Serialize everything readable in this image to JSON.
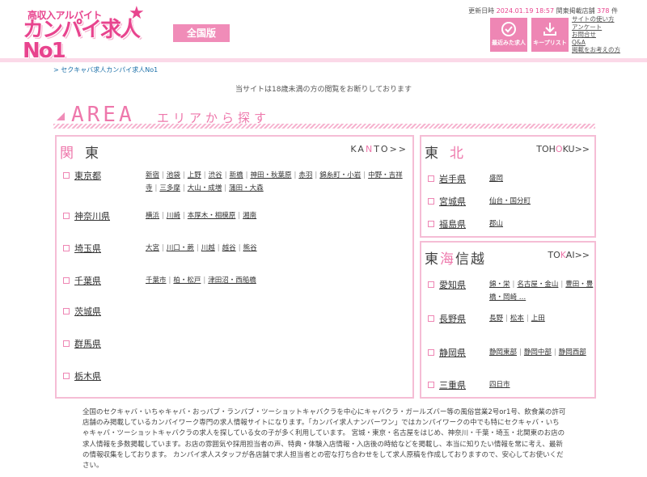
{
  "header": {
    "logo_tagline": "高収入アルバイト",
    "logo_brand": "カンパイ求人No1",
    "edition": "全国版",
    "updated_label": "更新日時",
    "updated_date": "2024.01.19 18:57",
    "shops_label": "関東掲載店舗",
    "shops_count": "378",
    "shops_unit": "件",
    "recent_label": "最近みた求人",
    "keep_label": "キープリスト",
    "links": [
      "サイトの使い方",
      "アンケート",
      "お問合せ",
      "Q&A",
      "掲載をお考えの方"
    ]
  },
  "breadcrumb": "> セクキャバ求人カンパイ求人No1",
  "notice": "当サイトは18歳未満の方の閲覧をお断りしております",
  "area_heading": {
    "en": "AREA",
    "jp": "エリアから探す"
  },
  "kanto": {
    "title_hl": "関",
    "title_rest": "東",
    "more_a": "KA",
    "more_hl": "N",
    "more_b": "TO>>",
    "prefs": [
      {
        "name": "東京都",
        "cities": [
          "新宿",
          "池袋",
          "上野",
          "渋谷",
          "新橋",
          "神田・秋葉原",
          "赤羽",
          "錦糸町・小岩",
          "中野・吉祥寺",
          "三多摩",
          "大山・成増",
          "蒲田・大森"
        ]
      },
      {
        "name": "神奈川県",
        "cities": [
          "横浜",
          "川崎",
          "本厚木・相模原",
          "湘南"
        ]
      },
      {
        "name": "埼玉県",
        "cities": [
          "大宮",
          "川口・蕨",
          "川越",
          "越谷",
          "熊谷"
        ]
      },
      {
        "name": "千葉県",
        "cities": [
          "千葉市",
          "柏・松戸",
          "津田沼・西船橋"
        ]
      },
      {
        "name": "茨城県",
        "cities": []
      },
      {
        "name": "群馬県",
        "cities": []
      },
      {
        "name": "栃木県",
        "cities": []
      }
    ]
  },
  "tohoku": {
    "title_a": "東",
    "title_hl": "北",
    "more_a": "TOH",
    "more_hl": "O",
    "more_b": "KU>>",
    "prefs": [
      {
        "name": "岩手県",
        "cities": [
          "盛岡"
        ]
      },
      {
        "name": "宮城県",
        "cities": [
          "仙台・国分町"
        ]
      },
      {
        "name": "福島県",
        "cities": [
          "郡山"
        ]
      }
    ]
  },
  "tokai": {
    "title_a": "東",
    "title_hl": "海",
    "title_b": "信越",
    "more_a": "TO",
    "more_hl": "K",
    "more_b": "AI>>",
    "prefs": [
      {
        "name": "愛知県",
        "cities": [
          "錦・栄",
          "名古屋・金山",
          "豊田・豊橋・岡崎 …"
        ]
      },
      {
        "name": "長野県",
        "cities": [
          "長野",
          "松本",
          "上田"
        ]
      },
      {
        "name": "静岡県",
        "cities": [
          "静岡東部",
          "静岡中部",
          "静岡西部"
        ]
      },
      {
        "name": "三重県",
        "cities": [
          "四日市"
        ]
      }
    ]
  },
  "footer_text": "全国のセクキャバ・いちゃキャバ・おっパブ・ランパブ・ツーショットキャバクラを中心にキャバクラ・ガールズバー等の風俗営業2号or1号、飲食業の許可店舗のみ掲載しているカンパイワーク専門の求人情報サイトになります。「カンパイ求人ナンバーワン」ではカンパイワークの中でも特にセクキャバ・いちゃキャバ・ツーショットキャバクラの求人を探している女の子が多く利用しています。 宮城・東京・名古屋をはじめ、神奈川・千葉・埼玉・北関東のお店の求人情報を多数掲載しています。お店の雰囲気や採用担当者の声、特典・体験入店情報・入店後の時給などを掲載し、本当に知りたい情報を常に考え、最新の情報収集をしております。 カンパイ求人スタッフが各店舗で求人担当者との密な打ち合わせをして求人原稿を作成しておりますので、安心してお使いください。"
}
